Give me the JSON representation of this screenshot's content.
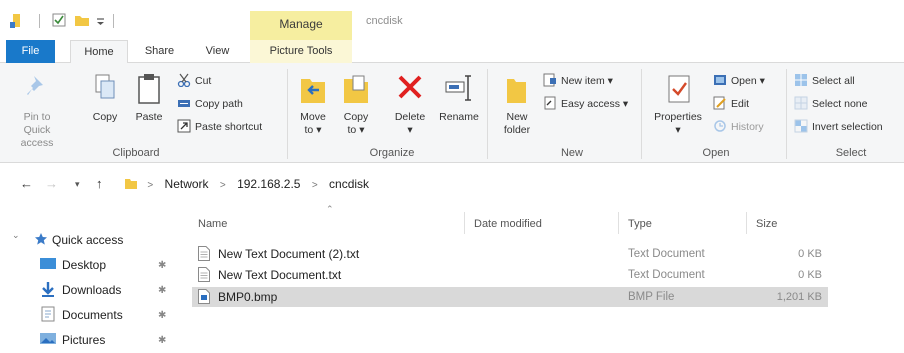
{
  "titlebar": {
    "contextual_tab": "Manage",
    "window_title": "cncdisk"
  },
  "tabs": {
    "file": "File",
    "home": "Home",
    "share": "Share",
    "view": "View",
    "picture_tools": "Picture Tools"
  },
  "ribbon": {
    "clipboard": {
      "label": "Clipboard",
      "pin": "Pin to Quick\naccess",
      "copy": "Copy",
      "paste": "Paste",
      "cut": "Cut",
      "copy_path": "Copy path",
      "paste_shortcut": "Paste shortcut"
    },
    "organize": {
      "label": "Organize",
      "move_to": "Move\nto ▾",
      "copy_to": "Copy\nto ▾",
      "delete": "Delete\n▾",
      "rename": "Rename"
    },
    "new": {
      "label": "New",
      "new_folder": "New\nfolder",
      "new_item": "New item ▾",
      "easy_access": "Easy access ▾"
    },
    "open": {
      "label": "Open",
      "properties": "Properties\n▾",
      "open": "Open ▾",
      "edit": "Edit",
      "history": "History"
    },
    "select": {
      "label": "Select",
      "select_all": "Select all",
      "select_none": "Select none",
      "invert_selection": "Invert selection"
    }
  },
  "address": {
    "crumbs": [
      "Network",
      "192.168.2.5",
      "cncdisk"
    ]
  },
  "navpane": {
    "quick_access": "Quick access",
    "items": [
      "Desktop",
      "Downloads",
      "Documents",
      "Pictures"
    ]
  },
  "filelist": {
    "columns": {
      "name": "Name",
      "date": "Date modified",
      "type": "Type",
      "size": "Size"
    },
    "rows": [
      {
        "name": "New Text Document (2).txt",
        "type": "Text Document",
        "size": "0 KB"
      },
      {
        "name": "New Text Document.txt",
        "type": "Text Document",
        "size": "0 KB"
      },
      {
        "name": "BMP0.bmp",
        "type": "BMP File",
        "size": "1,201 KB"
      }
    ]
  },
  "colors": {
    "accent": "#1979ca",
    "manage_tab": "#f6eea0",
    "ribbon_bg": "#f5f6f7",
    "selected_row": "#d9d9d9",
    "delete_red": "#e02020",
    "folder_yellow": "#f2c744"
  }
}
